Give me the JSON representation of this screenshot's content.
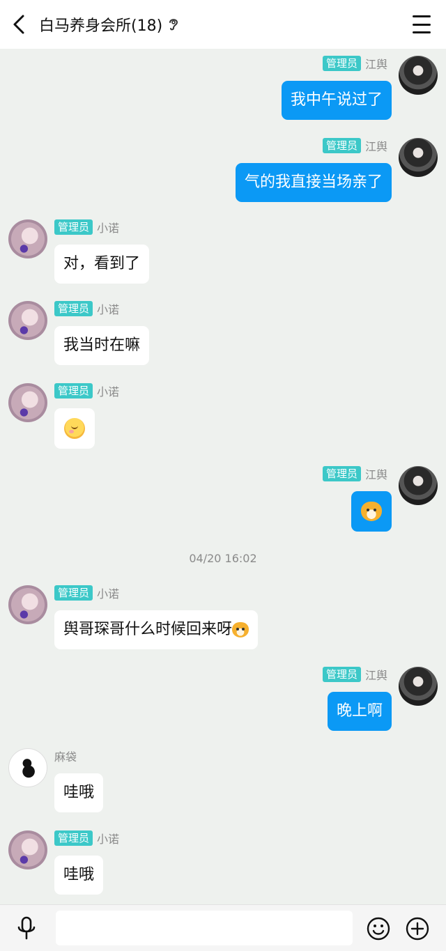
{
  "header": {
    "title": "白马养身会所(18)",
    "back_icon": "chevron-left-icon",
    "ear_icon": "ear-icon",
    "menu_icon": "menu-icon"
  },
  "badge_label": "管理员",
  "messages": [
    {
      "sender": "江舆",
      "role_badge": "管理员",
      "side": "right",
      "text": "我中午说过了"
    },
    {
      "sender": "江舆",
      "role_badge": "管理员",
      "side": "right",
      "text": "气的我直接当场亲了"
    },
    {
      "sender": "小诺",
      "role_badge": "管理员",
      "side": "left",
      "text": "对，看到了"
    },
    {
      "sender": "小诺",
      "role_badge": "管理员",
      "side": "left",
      "text": "我当时在嘛"
    },
    {
      "sender": "小诺",
      "role_badge": "管理员",
      "side": "left",
      "emoji": "blushing-face-emoji"
    },
    {
      "sender": "江舆",
      "role_badge": "管理员",
      "side": "right",
      "emoji": "tiger-face-emoji"
    },
    {
      "sender": "小诺",
      "role_badge": "管理员",
      "side": "left",
      "text": "舆哥琛哥什么时候回来呀",
      "trailing_emoji": "tiger-face-emoji"
    },
    {
      "sender": "江舆",
      "role_badge": "管理员",
      "side": "right",
      "text": "晚上啊"
    },
    {
      "sender": "麻袋",
      "side": "left",
      "text": "哇哦"
    },
    {
      "sender": "小诺",
      "role_badge": "管理员",
      "side": "left",
      "text": "哇哦"
    }
  ],
  "timestamp": "04/20 16:02",
  "input_bar": {
    "placeholder": "",
    "mic_icon": "microphone-icon",
    "emoji_icon": "smiley-icon",
    "plus_icon": "plus-circle-icon"
  },
  "colors": {
    "outgoing_bubble": "#0b99f5",
    "incoming_bubble": "#ffffff",
    "badge": "#3cc8c8",
    "background": "#eef1ee"
  }
}
